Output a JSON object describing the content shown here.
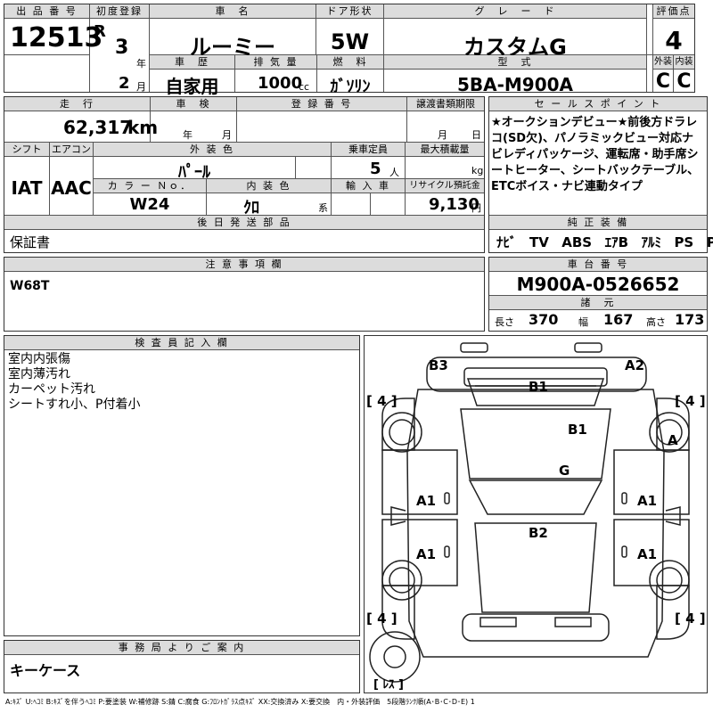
{
  "headers": {
    "lot_no": "出 品 番 号",
    "first_reg": "初度登録",
    "car_name": "車　名",
    "door": "ドア形状",
    "grade": "グ　レ　ー　ド",
    "score": "評価点",
    "history": "車　歴",
    "displacement": "排 気 量",
    "fuel": "燃　料",
    "model_code": "型　式",
    "exterior": "外装",
    "interior": "内装",
    "mileage": "走　行",
    "inspection": "車　検",
    "registration": "登 録 番 号",
    "transfer_deadline": "譲渡書類期限",
    "sales_points": "セ ー ル ス ポ イ ン ト",
    "shift": "シフト",
    "ac": "エアコン",
    "ext_color": "外 装 色",
    "capacity": "乗車定員",
    "max_load": "最大積載量",
    "color_no": "カ ラ ー Ｎｏ．",
    "int_color": "内 装 色",
    "import": "輸 入 車",
    "recycle": "リサイクル預託金",
    "later_parts": "後 日 発 送 部 品",
    "equipment": "純 正 装 備",
    "notes": "注 意 事 項 欄",
    "chassis": "車 台 番 号",
    "specs": "諸　元",
    "inspector": "検 査 員 記 入 欄",
    "office": "事 務 局 よ り ご 案 内"
  },
  "lot_no": "12513",
  "first_reg": {
    "era": "R",
    "year": "3",
    "year_unit": "年",
    "month": "2",
    "month_unit": "月"
  },
  "car_name": "ルーミー",
  "door": "5W",
  "grade": "カスタムG",
  "score": "4",
  "history": "自家用",
  "displacement": "1000",
  "displacement_unit": "cc",
  "fuel": "ｶﾞｿﾘﾝ",
  "model_code": "5BA-M900A",
  "exterior_grade": "C",
  "interior_grade": "C",
  "mileage": "62,317",
  "mileage_unit": "km",
  "inspection_year_unit": "年",
  "inspection_month_unit": "月",
  "transfer_month_unit": "月",
  "transfer_day_unit": "日",
  "sales_points": "★オークションデビュー★前後方ドラレコ(SD欠)、パノラミックビュー対応ナビレディパッケージ、運転席・助手席シートヒーター、シートバックテーブル、ETCボイス・ナビ連動タイプ",
  "shift": "IAT",
  "ac": "AAC",
  "ext_color": "ﾊﾟｰﾙ",
  "capacity": "5",
  "capacity_unit": "人",
  "max_load_unit": "kg",
  "color_no": "W24",
  "int_color": "ｸﾛ",
  "int_color_unit": "系",
  "recycle": "9,130",
  "recycle_unit": "円",
  "later_parts": "保証書",
  "equipment": [
    "ﾅﾋﾞ",
    "TV",
    "ABS",
    "ｴｱB",
    "ｱﾙﾐ",
    "PS",
    "PW"
  ],
  "notes": "W68T",
  "chassis": "M900A-0526652",
  "specs": {
    "length_label": "長さ",
    "length": "370",
    "width_label": "幅",
    "width": "167",
    "height_label": "高さ",
    "height": "173"
  },
  "inspector_notes": [
    "室内内張傷",
    "室内薄汚れ",
    "カーペット汚れ",
    "シートすれ小、P付着小"
  ],
  "office_notes": "キーケース",
  "legend": "A:ｷｽﾞ U:ﾍｺﾐ B:ｷｽﾞを伴うﾍｺﾐ P:要塗装 W:補修跡 S:錆 C:腐食 G:ﾌﾛﾝﾄｶﾞﾗｽ点ｷｽﾞ XX:交換済み X:要交換　内・外装評価　5段階ﾗﾝｸ順(A･B･C･D･E) 1",
  "diagram": {
    "tire_left_top": "[ 4 ]",
    "tire_right_top": "[ 4 ]",
    "tire_left_bottom": "[ 4 ]",
    "tire_right_bottom": "[ 4 ]",
    "spare": "[ ﾚｽ ]",
    "marks": {
      "b3": "B3",
      "a2": "A2",
      "b1_top": "B1",
      "b1_mid": "B1",
      "a_right": "A",
      "g": "G",
      "a1_lf": "A1",
      "a1_rf": "A1",
      "a1_lr": "A1",
      "a1_rr": "A1",
      "b2": "B2"
    }
  }
}
